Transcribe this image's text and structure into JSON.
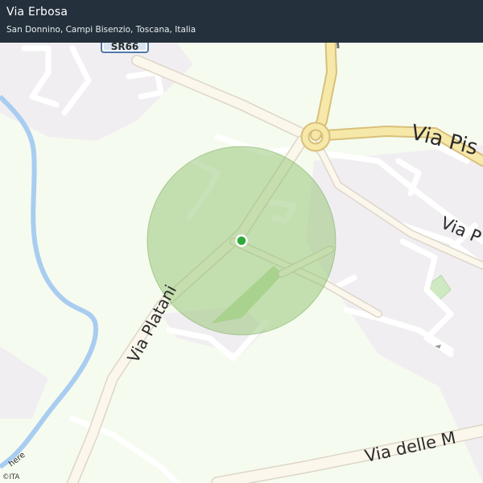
{
  "header": {
    "title": "Via Erbosa",
    "subtitle": "San Donnino, Campi Bisenzio, Toscana, Italia"
  },
  "map": {
    "road_labels": {
      "via_platani": "Via Platani",
      "via_pis": "Via Pis",
      "via_p": "Via P",
      "via_delle_m": "Via delle M",
      "river": "here"
    },
    "shield": "SR66",
    "attribution": "©ITA",
    "colors": {
      "background": "#f6fbef",
      "header": "#24303b",
      "accuracy_circle": "#8cc06b",
      "location_dot": "#2faa3b",
      "river": "#a9cdf0",
      "main_road": "#f6e8a8",
      "road": "#fbf7ec",
      "buildings": "#f0eef0"
    }
  }
}
